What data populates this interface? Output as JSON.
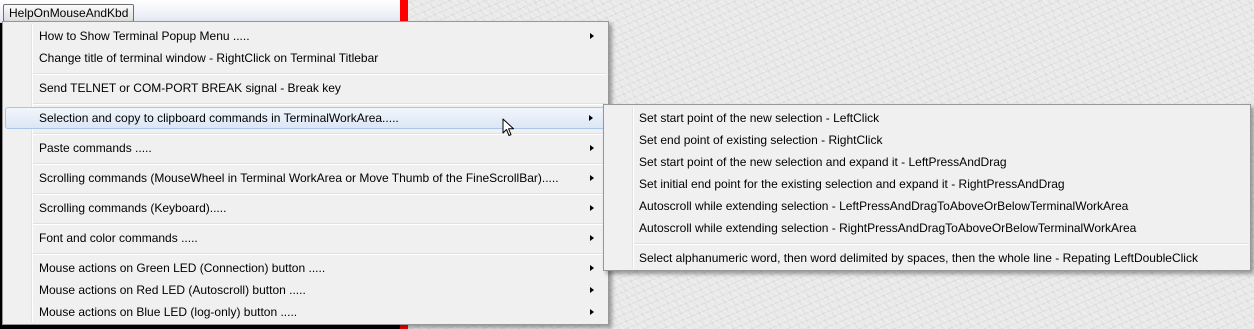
{
  "menubar": {
    "button_label": "HelpOnMouseAndKbd"
  },
  "main_menu": {
    "items": [
      {
        "label": "How to Show Terminal Popup Menu .....",
        "submenu": true
      },
      {
        "label": "Change title of terminal window - RightClick on Terminal Titlebar",
        "submenu": false
      },
      {
        "label": "Send TELNET or COM-PORT BREAK signal - Break key",
        "submenu": false
      },
      {
        "label": "Selection and copy to clipboard commands in TerminalWorkArea.....",
        "submenu": true,
        "highlighted": true
      },
      {
        "label": "Paste commands .....",
        "submenu": true
      },
      {
        "label": "Scrolling commands (MouseWheel in Terminal WorkArea or Move Thumb of the FineScrollBar).....",
        "submenu": true
      },
      {
        "label": "Scrolling commands (Keyboard).....",
        "submenu": true
      },
      {
        "label": "Font and color commands .....",
        "submenu": true
      },
      {
        "label": "Mouse actions on Green LED (Connection) button .....",
        "submenu": true
      },
      {
        "label": "Mouse actions on Red LED (Autoscroll) button .....",
        "submenu": true
      },
      {
        "label": "Mouse actions on Blue LED (log-only) button .....",
        "submenu": true
      }
    ]
  },
  "sub_menu": {
    "items": [
      {
        "label": "Set start point of the new selection - LeftClick"
      },
      {
        "label": "Set end point of existing selection - RightClick"
      },
      {
        "label": "Set start point of the new selection and expand it - LeftPressAndDrag"
      },
      {
        "label": "Set initial end point for the existing selection and expand it - RightPressAndDrag"
      },
      {
        "label": "Autoscroll while extending selection - LeftPressAndDragToAboveOrBelowTerminalWorkArea"
      },
      {
        "label": "Autoscroll while extending selection - RightPressAndDragToAboveOrBelowTerminalWorkArea"
      },
      {
        "label": "Select alphanumeric word, then word delimited by spaces, then the whole line - Repating LeftDoubleClick"
      }
    ]
  },
  "colors": {
    "menu_background": "#f0f0f0",
    "highlight_border": "#a8c6ec",
    "red_bar": "#ff0000",
    "app_background": "#000000"
  },
  "icons": {
    "submenu_arrow": "chevron-right-icon",
    "cursor": "mouse-pointer-icon"
  }
}
